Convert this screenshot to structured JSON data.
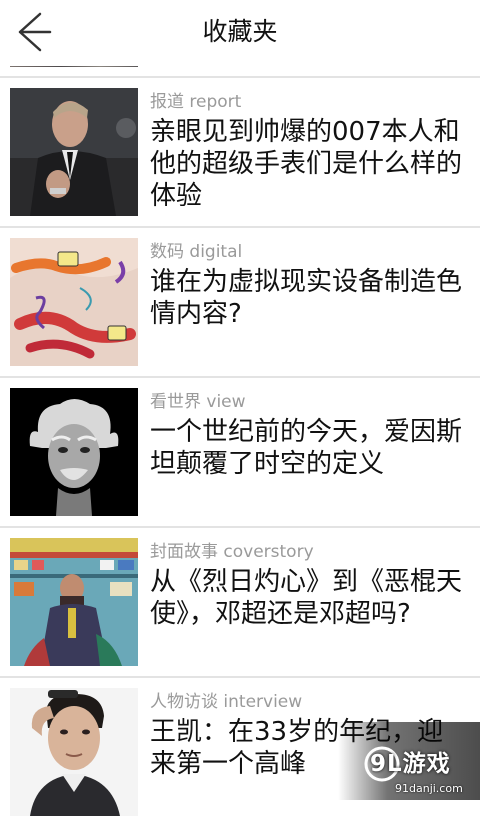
{
  "header": {
    "title": "收藏夹",
    "back_icon": "arrow-left-icon"
  },
  "items": [
    {
      "category": "报道 report",
      "title": "亲眼见到帅爆的007本人和他的超级手表们是什么样的体验",
      "thumbnail": "man-in-suit-photo"
    },
    {
      "category": "数码 digital",
      "title": "谁在为虚拟现实设备制造色情内容?",
      "thumbnail": "vr-illustration"
    },
    {
      "category": "看世界 view",
      "title": "一个世纪前的今天，爱因斯坦颠覆了时空的定义",
      "thumbnail": "einstein-portrait"
    },
    {
      "category": "封面故事 coverstory",
      "title": "从《烈日灼心》到《恶棍天使》，邓超还是邓超吗?",
      "thumbnail": "actor-sitting-photo"
    },
    {
      "category": "人物访谈 interview",
      "title": "王凯：在33岁的年纪，迎来第一个高峰",
      "thumbnail": "actor-portrait-photo"
    }
  ],
  "watermark": {
    "brand": "9L游戏",
    "url": "91danji.com"
  }
}
